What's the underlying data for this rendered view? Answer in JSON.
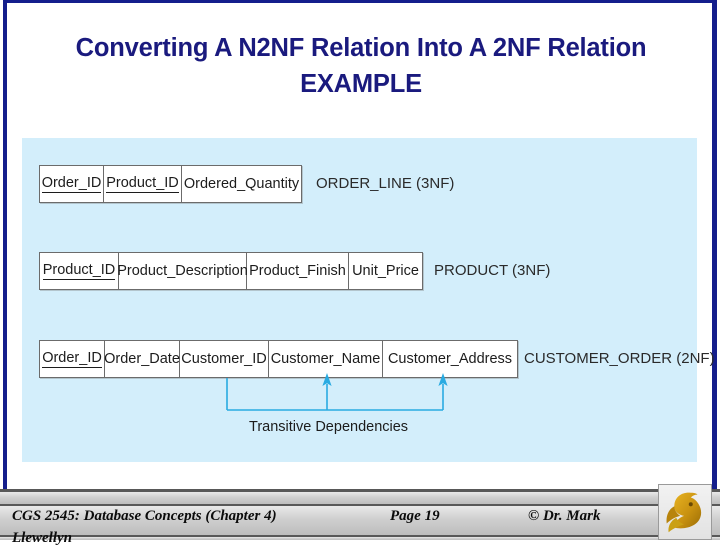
{
  "slide": {
    "title_line1": "Converting A N2NF Relation Into A 2NF Relation",
    "title_line2": "EXAMPLE",
    "title_color": "#1a1a7e",
    "panel_color": "#d3eefb",
    "accent_color": "#29abe2"
  },
  "relations": [
    {
      "name": "ORDER_LINE (3NF)",
      "attributes": [
        {
          "label": "Order_ID",
          "primary_key": true
        },
        {
          "label": "Product_ID",
          "primary_key": true
        },
        {
          "label": "Ordered_Quantity",
          "primary_key": false
        }
      ]
    },
    {
      "name": "PRODUCT (3NF)",
      "attributes": [
        {
          "label": "Product_ID",
          "primary_key": true
        },
        {
          "label": "Product_Description",
          "primary_key": false
        },
        {
          "label": "Product_Finish",
          "primary_key": false
        },
        {
          "label": "Unit_Price",
          "primary_key": false
        }
      ]
    },
    {
      "name": "CUSTOMER_ORDER (2NF)",
      "attributes": [
        {
          "label": "Order_ID",
          "primary_key": true
        },
        {
          "label": "Order_Date",
          "primary_key": false
        },
        {
          "label": "Customer_ID",
          "primary_key": false
        },
        {
          "label": "Customer_Name",
          "primary_key": false
        },
        {
          "label": "Customer_Address",
          "primary_key": false
        }
      ]
    }
  ],
  "dependency_annotation": {
    "caption": "Transitive Dependencies",
    "source_attribute": "Customer_ID",
    "target_attributes": [
      "Customer_Name",
      "Customer_Address"
    ]
  },
  "footer": {
    "course": "CGS 2545: Database Concepts  (Chapter 4)",
    "page": "Page 19",
    "copyright": "© Dr. Mark",
    "author_wrapped": "Llewellyn",
    "logo": "ucf-pegasus-logo"
  }
}
